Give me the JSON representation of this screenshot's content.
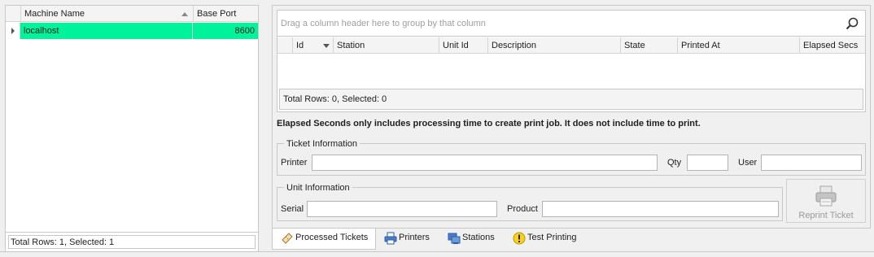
{
  "machines": {
    "columns": [
      "Machine Name",
      "Base Port"
    ],
    "rows": [
      {
        "name": "localhost",
        "port": "8600"
      }
    ],
    "footer": "Total Rows: 1, Selected: 1"
  },
  "jobs": {
    "group_hint": "Drag a column header here to group by that column",
    "columns": [
      "Id",
      "Station",
      "Unit Id",
      "Description",
      "State",
      "Printed At",
      "Elapsed Secs"
    ],
    "footer": "Total Rows: 0, Selected: 0"
  },
  "note": "Elapsed Seconds only includes processing time to create print job. It does not include time to print.",
  "ticket_info": {
    "title": "Ticket Information",
    "printer_label": "Printer",
    "printer_value": "",
    "qty_label": "Qty",
    "qty_value": "",
    "user_label": "User",
    "user_value": ""
  },
  "unit_info": {
    "title": "Unit Information",
    "serial_label": "Serial",
    "serial_value": "",
    "product_label": "Product",
    "product_value": ""
  },
  "reprint_label": "Reprint Ticket",
  "tabs": [
    {
      "label": "Processed Tickets",
      "icon": "ticket-icon"
    },
    {
      "label": "Printers",
      "icon": "printer-icon"
    },
    {
      "label": "Stations",
      "icon": "stations-icon"
    },
    {
      "label": "Test Printing",
      "icon": "warning-icon"
    }
  ],
  "colors": {
    "selection": "#00f29a",
    "accent": "#2a5caa"
  }
}
